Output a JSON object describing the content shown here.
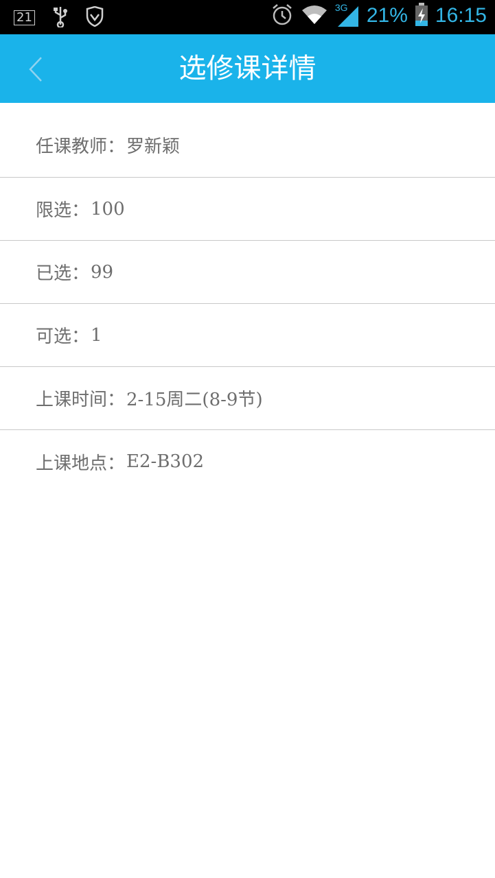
{
  "status_bar": {
    "notification_count": "21",
    "battery": "21%",
    "network": "3G",
    "time": "16:15"
  },
  "app_bar": {
    "title": "选修课详情"
  },
  "details": [
    {
      "label": "任课教师：",
      "value": "罗新颖"
    },
    {
      "label": "限选：",
      "value": "100"
    },
    {
      "label": "已选：",
      "value": "99"
    },
    {
      "label": "可选：",
      "value": "1"
    },
    {
      "label": "上课时间：",
      "value": "2-15周二(8-9节)"
    },
    {
      "label": "上课地点：",
      "value": "E2-B302"
    }
  ],
  "colors": {
    "app_bar": "#1ab3ea",
    "status_accent": "#33b5e5",
    "text": "#6e6e6e",
    "divider": "#c8c8c8"
  }
}
